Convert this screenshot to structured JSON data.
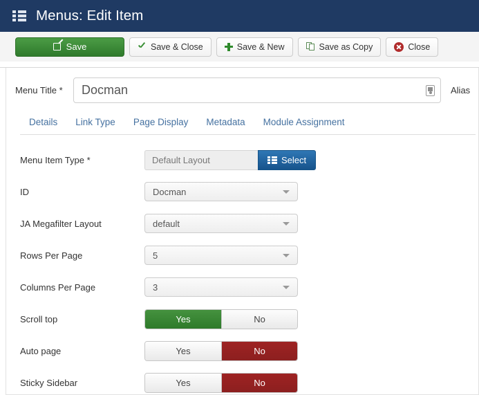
{
  "header": {
    "icon": "list-grid-icon",
    "title": "Menus: Edit Item"
  },
  "toolbar": {
    "buttons": [
      {
        "label": "Save",
        "icon": "pencil-square-icon",
        "style": "primary-green"
      },
      {
        "label": "Save & Close",
        "icon": "check-icon",
        "style": "default"
      },
      {
        "label": "Save & New",
        "icon": "plus-icon",
        "style": "default"
      },
      {
        "label": "Save as Copy",
        "icon": "copy-icon",
        "style": "default"
      },
      {
        "label": "Close",
        "icon": "close-circle-icon",
        "style": "default"
      }
    ]
  },
  "title_row": {
    "label": "Menu Title *",
    "value": "Docman",
    "placeholder": "",
    "field_icon": "keyboard-icon",
    "alias_label": "Alias"
  },
  "tabs": [
    {
      "label": "Details",
      "active": true
    },
    {
      "label": "Link Type",
      "active": false
    },
    {
      "label": "Page Display",
      "active": false
    },
    {
      "label": "Metadata",
      "active": false
    },
    {
      "label": "Module Assignment",
      "active": false
    }
  ],
  "form": {
    "menu_item_type": {
      "label": "Menu Item Type *",
      "value": "Default Layout",
      "select_button": "Select",
      "select_icon": "list-grid-icon"
    },
    "selects": [
      {
        "label": "ID",
        "value": "Docman"
      },
      {
        "label": "JA Megafilter Layout",
        "value": "default"
      },
      {
        "label": "Rows Per Page",
        "value": "5"
      },
      {
        "label": "Columns Per Page",
        "value": "3"
      }
    ],
    "toggles": [
      {
        "label": "Scroll top",
        "yes": "Yes",
        "no": "No",
        "selected": "yes"
      },
      {
        "label": "Auto page",
        "yes": "Yes",
        "no": "No",
        "selected": "no"
      },
      {
        "label": "Sticky Sidebar",
        "yes": "Yes",
        "no": "No",
        "selected": "no"
      }
    ]
  },
  "colors": {
    "header_bg": "#1f3a63",
    "toolbar_bg": "#f4f4f4",
    "save_green": "#3b8a36",
    "select_blue": "#17538c",
    "toggle_on_green": "#38842f",
    "toggle_on_red": "#941f1f",
    "tab_link": "#4571a0"
  }
}
